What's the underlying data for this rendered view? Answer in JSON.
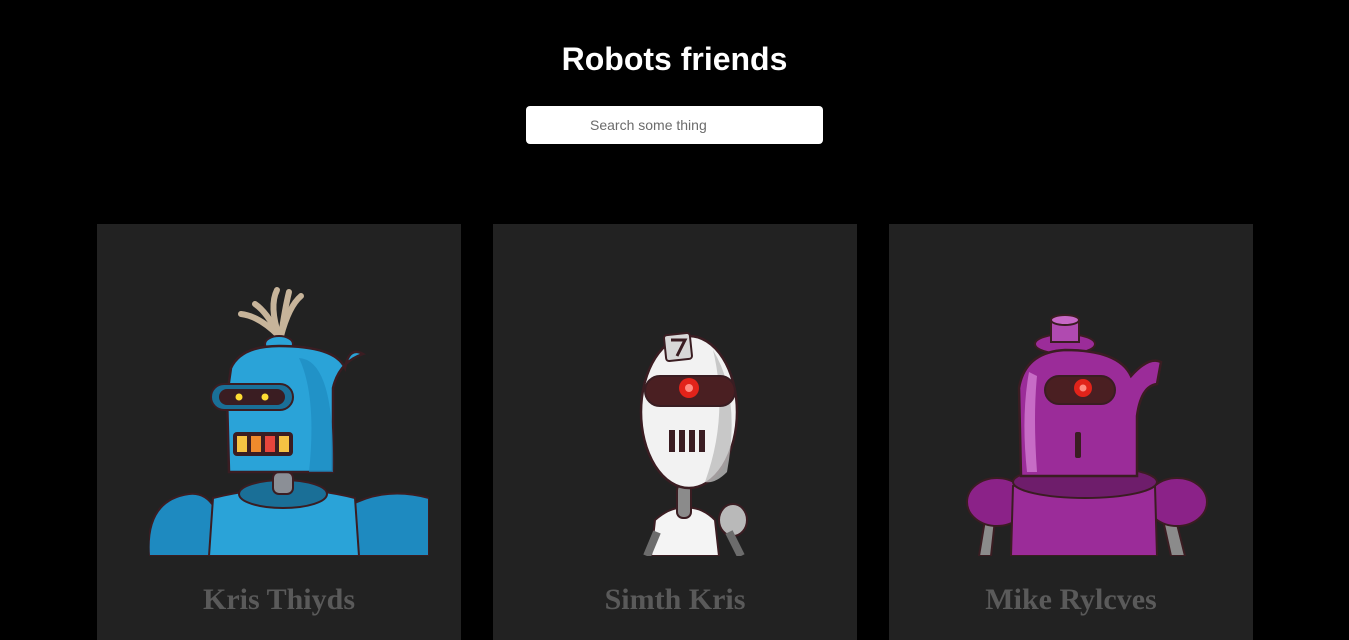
{
  "header": {
    "title": "Robots friends"
  },
  "search": {
    "placeholder": "Search some thing",
    "value": ""
  },
  "robots": [
    {
      "name": "Kris Thiyds",
      "color": "#2aa3d8",
      "icon": "blue-robot-avatar"
    },
    {
      "name": "Simth Kris",
      "color": "#f2f2f2",
      "icon": "white-robot-avatar"
    },
    {
      "name": "Mike Rylcves",
      "color": "#9b2c99",
      "icon": "purple-robot-avatar"
    }
  ]
}
